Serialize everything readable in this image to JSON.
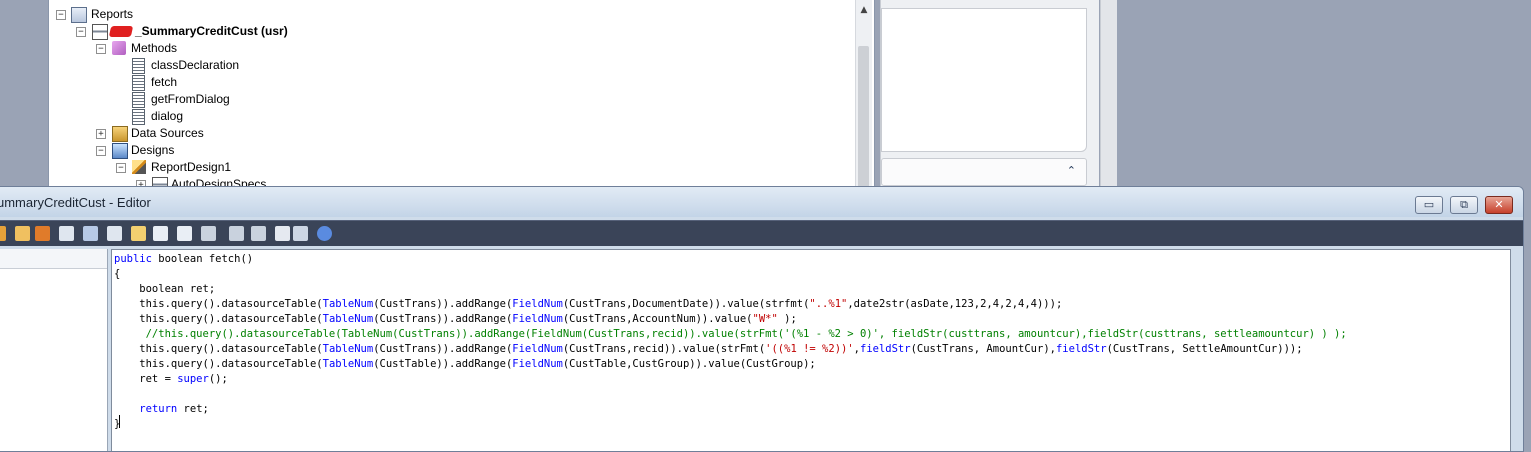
{
  "aot_tree": {
    "nodes": [
      {
        "label": "Reports",
        "expander": "−",
        "icon": "reports-icon"
      },
      {
        "label": "_SummaryCreditCust (usr)",
        "expander": "−",
        "icon": "report-icon"
      },
      {
        "label": "Methods",
        "expander": "−",
        "icon": "methods-icon"
      },
      {
        "label": "classDeclaration",
        "icon": "method-icon"
      },
      {
        "label": "fetch",
        "icon": "method-icon"
      },
      {
        "label": "getFromDialog",
        "icon": "method-icon"
      },
      {
        "label": "dialog",
        "icon": "method-icon"
      },
      {
        "label": "Data Sources",
        "expander": "+",
        "icon": "data-sources-icon"
      },
      {
        "label": "Designs",
        "expander": "−",
        "icon": "designs-icon"
      },
      {
        "label": "ReportDesign1",
        "expander": "−",
        "icon": "report-design-icon"
      },
      {
        "label": "AutoDesignSpecs",
        "expander": "+",
        "icon": "auto-design-icon"
      }
    ]
  },
  "editor": {
    "title": "ummaryCreditCust - Editor",
    "buttons": {
      "minimize": "▭",
      "restore": "⧉",
      "close": "✕"
    },
    "toolbar_icons": [
      "new-icon",
      "hand-icon",
      "hand-orange-icon",
      "keyboard-icon",
      "lookup-icon",
      "find-icon",
      "compile-icon",
      "import-icon",
      "export-icon",
      "layers-icon",
      "database-icon",
      "undo-icon",
      "globe-icon",
      "properties-icon",
      "help-icon"
    ],
    "code_lines": [
      [
        {
          "t": "public",
          "c": "kw"
        },
        {
          "t": " boolean fetch()"
        }
      ],
      [
        {
          "t": "{"
        }
      ],
      [
        {
          "t": "    boolean ret;"
        }
      ],
      [
        {
          "t": "    this.query().datasourceTable("
        },
        {
          "t": "TableNum",
          "c": "fn"
        },
        {
          "t": "(CustTrans)).addRange("
        },
        {
          "t": "FieldNum",
          "c": "fn"
        },
        {
          "t": "(CustTrans,DocumentDate)).value(strfmt("
        },
        {
          "t": "\"..%1\"",
          "c": "str"
        },
        {
          "t": ",date2str(asDate,123,2,4,2,4,4)));"
        }
      ],
      [
        {
          "t": "    this.query().datasourceTable("
        },
        {
          "t": "TableNum",
          "c": "fn"
        },
        {
          "t": "(CustTrans)).addRange("
        },
        {
          "t": "FieldNum",
          "c": "fn"
        },
        {
          "t": "(CustTrans,AccountNum)).value("
        },
        {
          "t": "\"W*\"",
          "c": "str"
        },
        {
          "t": " );"
        }
      ],
      [
        {
          "t": "     //this.query().datasourceTable(TableNum(CustTrans)).addRange(FieldNum(CustTrans,recid)).value(strFmt('(%1 - %2 > 0)', fieldStr(custtrans, amountcur),fieldStr(custtrans, settleamountcur) ) );",
          "c": "cm"
        }
      ],
      [
        {
          "t": "    this.query().datasourceTable("
        },
        {
          "t": "TableNum",
          "c": "fn"
        },
        {
          "t": "(CustTrans)).addRange("
        },
        {
          "t": "FieldNum",
          "c": "fn"
        },
        {
          "t": "(CustTrans,recid)).value(strFmt("
        },
        {
          "t": "'((%1 != %2))'",
          "c": "str"
        },
        {
          "t": ","
        },
        {
          "t": "fieldStr",
          "c": "fn"
        },
        {
          "t": "(CustTrans, AmountCur),"
        },
        {
          "t": "fieldStr",
          "c": "fn"
        },
        {
          "t": "(CustTrans, SettleAmountCur)));"
        }
      ],
      [
        {
          "t": "    this.query().datasourceTable("
        },
        {
          "t": "TableNum",
          "c": "fn"
        },
        {
          "t": "(CustTable)).addRange("
        },
        {
          "t": "FieldNum",
          "c": "fn"
        },
        {
          "t": "(CustTable,CustGroup)).value(CustGroup);"
        }
      ],
      [
        {
          "t": "    ret = "
        },
        {
          "t": "super",
          "c": "kw"
        },
        {
          "t": "();"
        }
      ],
      [
        {
          "t": ""
        }
      ],
      [
        {
          "t": "    "
        },
        {
          "t": "return",
          "c": "kw"
        },
        {
          "t": " ret;"
        }
      ],
      [
        {
          "t": "}"
        }
      ]
    ]
  }
}
